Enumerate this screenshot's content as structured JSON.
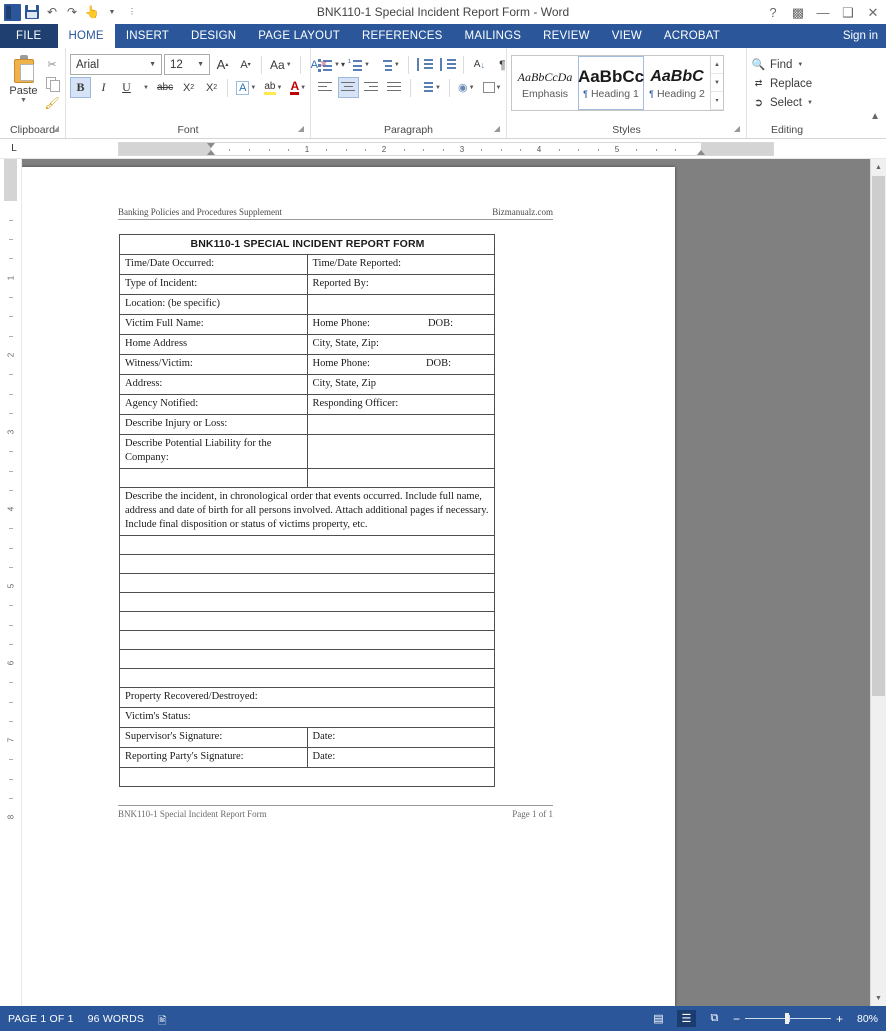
{
  "window": {
    "title": "BNK110-1 Special Incident Report Form - Word",
    "quick_access": [
      "save-icon",
      "undo-icon",
      "redo-icon",
      "touch-mode-icon",
      "customize-qat-icon"
    ],
    "controls": {
      "help": "?",
      "ribbon_display": "ribbon-options-icon",
      "minimize": "—",
      "restore": "❐",
      "close": "✕"
    },
    "sign_in": "Sign in"
  },
  "tabs": [
    {
      "label": "FILE",
      "active": false
    },
    {
      "label": "HOME",
      "active": true
    },
    {
      "label": "INSERT",
      "active": false
    },
    {
      "label": "DESIGN",
      "active": false
    },
    {
      "label": "PAGE LAYOUT",
      "active": false
    },
    {
      "label": "REFERENCES",
      "active": false
    },
    {
      "label": "MAILINGS",
      "active": false
    },
    {
      "label": "REVIEW",
      "active": false
    },
    {
      "label": "VIEW",
      "active": false
    },
    {
      "label": "ACROBAT",
      "active": false
    }
  ],
  "ribbon": {
    "clipboard": {
      "group_label": "Clipboard",
      "paste_label": "Paste",
      "items": [
        "cut-icon",
        "copy-icon",
        "format-painter-icon"
      ]
    },
    "font": {
      "group_label": "Font",
      "font_name": "Arial",
      "font_size": "12",
      "buttons": {
        "grow_font": "A",
        "shrink_font": "A",
        "change_case": "Aa",
        "clear_formatting": "clear-formatting-icon",
        "bold": "B",
        "italic": "I",
        "underline": "U",
        "strikethrough": "abc",
        "subscript": "X₂",
        "superscript": "X²",
        "text_effects": "A",
        "highlight": "ab",
        "font_color": "A"
      }
    },
    "paragraph": {
      "group_label": "Paragraph",
      "buttons": [
        "bullets-icon",
        "numbering-icon",
        "multilevel-list-icon",
        "decrease-indent-icon",
        "increase-indent-icon",
        "sort-icon",
        "show-marks-icon",
        "align-left-icon",
        "align-center-icon",
        "align-right-icon",
        "justify-icon",
        "line-spacing-icon",
        "shading-icon",
        "borders-icon"
      ],
      "show_marks_glyph": "¶",
      "sort_glyph": "A↓",
      "active": "align-center-icon"
    },
    "styles": {
      "group_label": "Styles",
      "gallery": [
        {
          "preview": "AaBbCcDa",
          "name": "Emphasis",
          "selected": false,
          "pilcrow": false
        },
        {
          "preview": "AaBbCc",
          "name": "Heading 1",
          "selected": true,
          "pilcrow": true
        },
        {
          "preview": "AaBbC",
          "name": "Heading 2",
          "selected": false,
          "pilcrow": true
        }
      ]
    },
    "editing": {
      "group_label": "Editing",
      "items": [
        {
          "label": "Find",
          "icon": "find-icon",
          "has_caret": true
        },
        {
          "label": "Replace",
          "icon": "replace-icon",
          "has_caret": false
        },
        {
          "label": "Select",
          "icon": "select-icon",
          "has_caret": true
        }
      ]
    },
    "collapse": "collapse-ribbon-icon"
  },
  "ruler": {
    "corner_tab": "L",
    "h_numbers": [
      "1",
      "2",
      "3",
      "4",
      "5"
    ],
    "v_numbers": [
      "1",
      "2",
      "3",
      "4",
      "5",
      "6",
      "7",
      "8"
    ]
  },
  "document": {
    "header": {
      "left": "Banking Policies and Procedures Supplement",
      "right": "Bizmanualz.com"
    },
    "title": "BNK110-1 SPECIAL INCIDENT REPORT FORM",
    "rows": [
      {
        "left": "Time/Date Occurred:",
        "right": "Time/Date Reported:",
        "right_extra": ""
      },
      {
        "left": "Type of Incident:",
        "right": "Reported By:",
        "right_extra": ""
      },
      {
        "left": "Location:  (be specific)",
        "right": "",
        "right_extra": ""
      },
      {
        "left": "Victim Full Name:",
        "right": "Home Phone:",
        "right_extra": "DOB:"
      },
      {
        "left": "Home Address",
        "right": "City, State, Zip:",
        "right_extra": ""
      },
      {
        "left": "Witness/Victim:",
        "right": "Home Phone:",
        "right_extra": "DOB:"
      },
      {
        "left": "Address:",
        "right": "City, State, Zip",
        "right_extra": ""
      },
      {
        "left": "Agency Notified:",
        "right": "Responding Officer:",
        "right_extra": ""
      },
      {
        "left": "Describe Injury or Loss:",
        "right": "",
        "right_extra": ""
      },
      {
        "left": "Describe Potential Liability for the Company:",
        "right": "",
        "right_extra": ""
      },
      {
        "left": "",
        "right": "",
        "right_extra": ""
      }
    ],
    "instructions": "Describe the incident, in chronological order that events occurred.  Include full name, address and date of birth for all persons involved.  Attach additional pages if necessary.  Include final disposition or status of victims property, etc.",
    "blank_line_count": 8,
    "bottom_rows": [
      {
        "left": "Property Recovered/Destroyed:",
        "right": null
      },
      {
        "left": "Victim's Status:",
        "right": null
      },
      {
        "left": "Supervisor's Signature:",
        "right": "Date:"
      },
      {
        "left": "Reporting Party's Signature:",
        "right": "Date:"
      }
    ],
    "footer": {
      "left": "BNK110-1 Special Incident Report Form",
      "right": "Page 1 of 1"
    }
  },
  "status": {
    "page": "PAGE 1 OF 1",
    "words": "96 WORDS",
    "proofing_icon": "proofing-errors-icon",
    "views": [
      {
        "name": "read-mode-icon",
        "glyph": "▤",
        "selected": false
      },
      {
        "name": "print-layout-icon",
        "glyph": "☰",
        "selected": true
      },
      {
        "name": "web-layout-icon",
        "glyph": "⧉",
        "selected": false
      }
    ],
    "zoom_out": "−",
    "zoom_in": "+",
    "zoom_level": "80%"
  },
  "colors": {
    "accent": "#2b579a",
    "file_tab": "#1e3f70",
    "workspace": "#808080",
    "page": "#ffffff"
  }
}
